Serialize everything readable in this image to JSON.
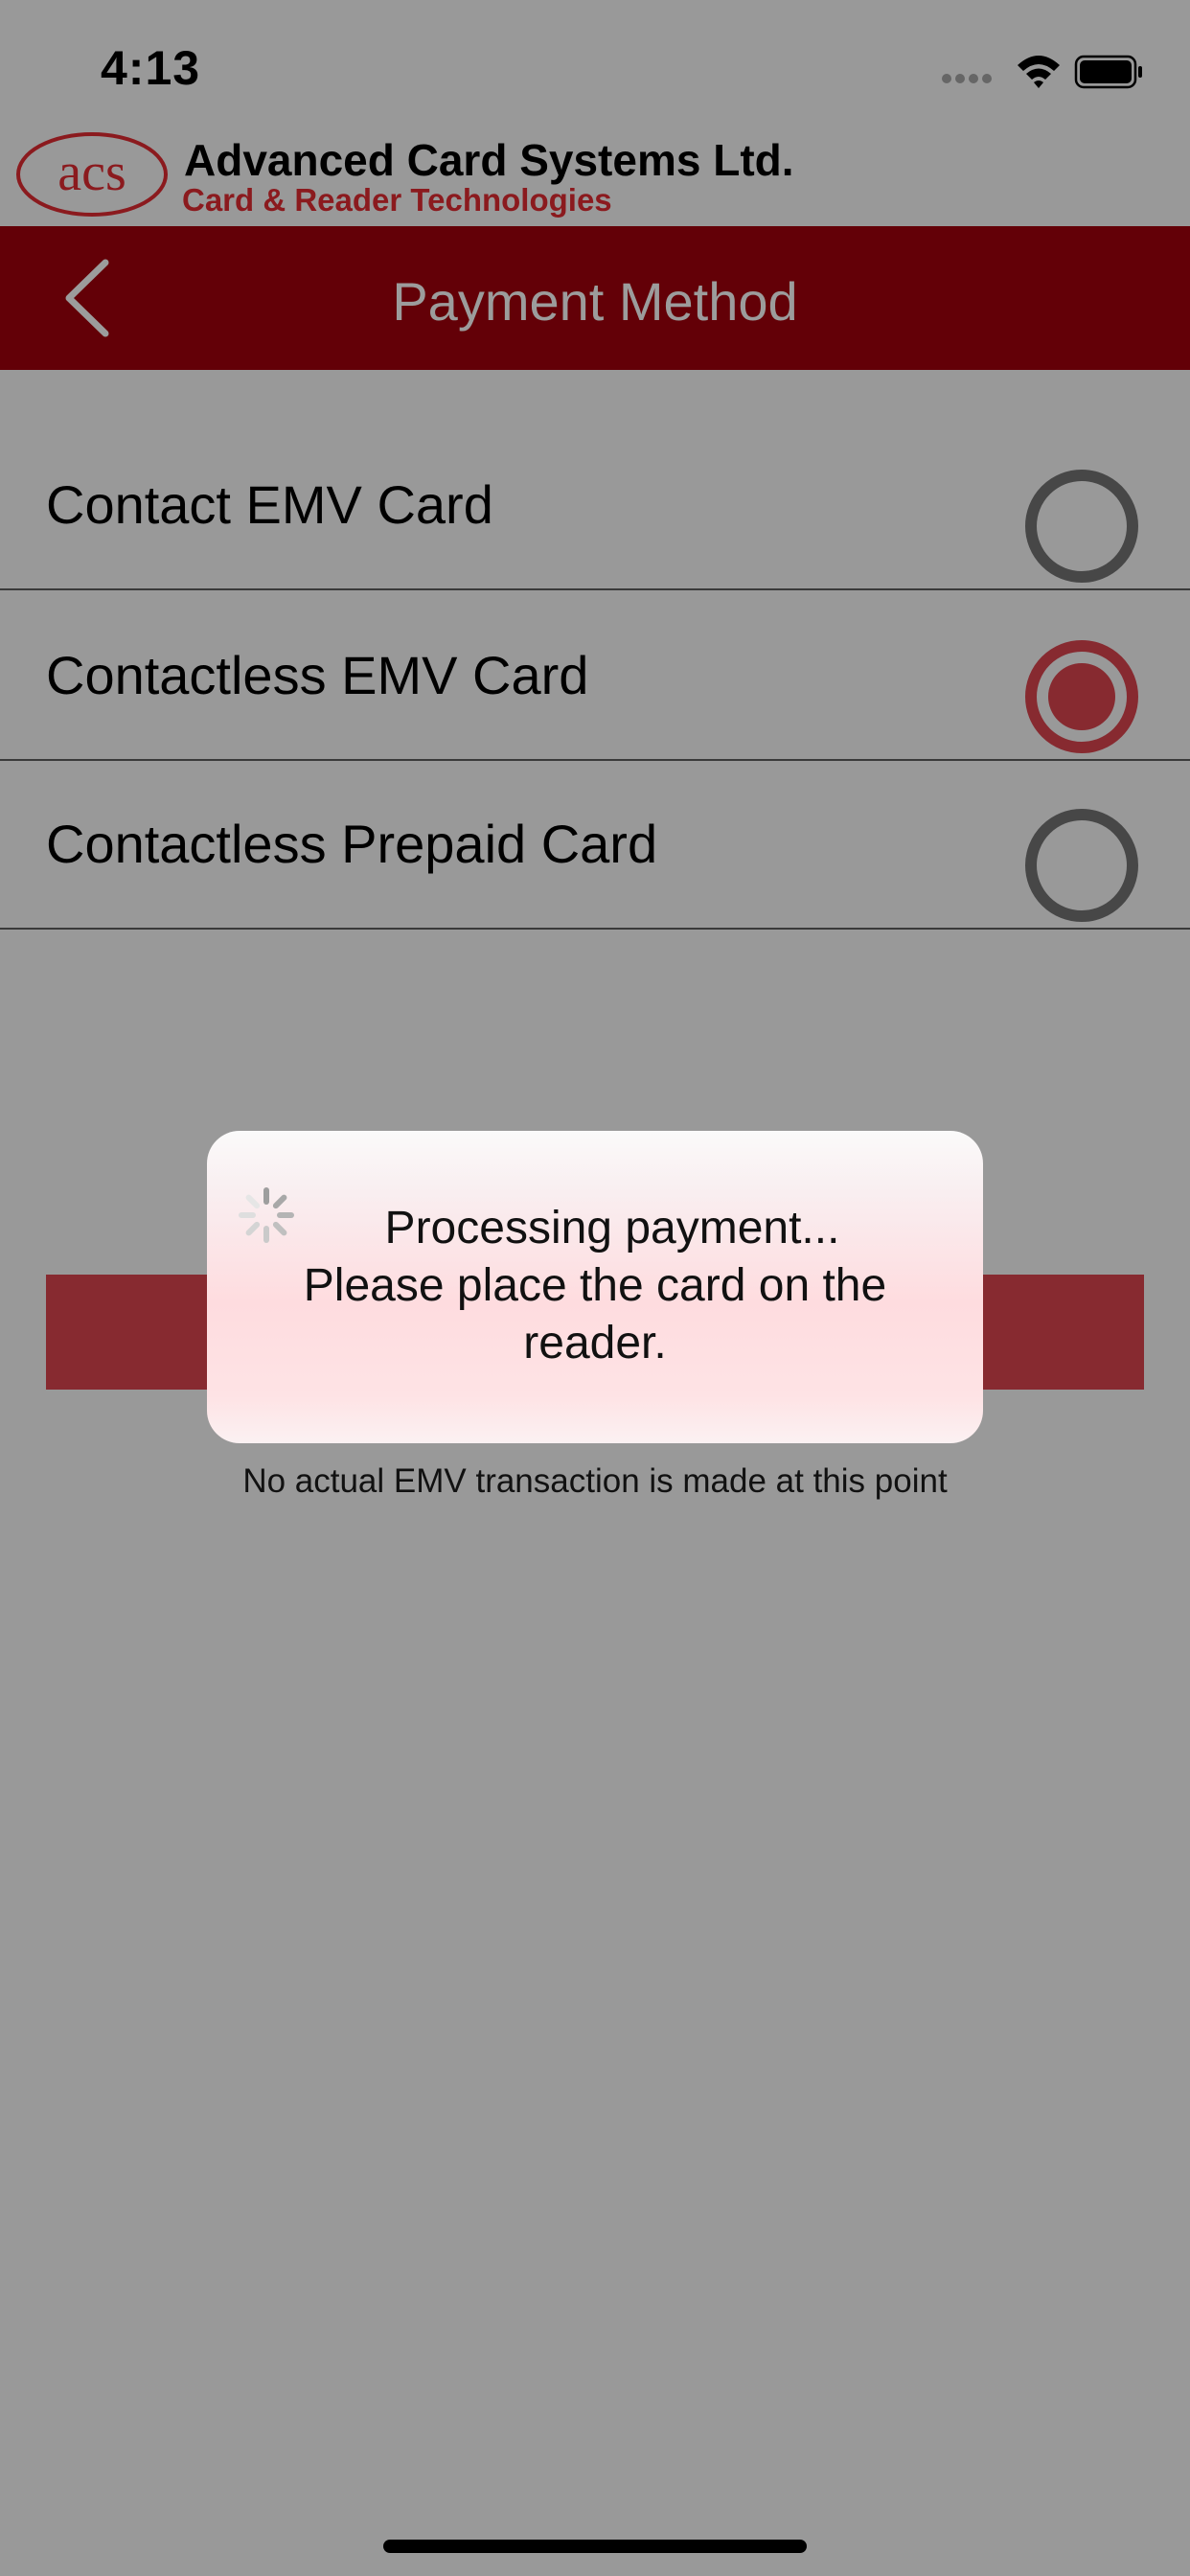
{
  "status_bar": {
    "time": "4:13",
    "icons": [
      "signal-icon",
      "wifi-icon",
      "battery-icon"
    ]
  },
  "logo": {
    "mark": "acs",
    "title": "Advanced Card Systems Ltd.",
    "subtitle": "Card & Reader Technologies"
  },
  "nav": {
    "back_icon": "chevron-left-icon",
    "title": "Payment Method"
  },
  "payment_methods": [
    {
      "label": "Contact EMV Card",
      "selected": false
    },
    {
      "label": "Contactless EMV Card",
      "selected": true
    },
    {
      "label": "Contactless Prepaid Card",
      "selected": false
    }
  ],
  "footnote": "No actual EMV transaction is made at this point",
  "popup": {
    "line1": "Processing payment...",
    "line2": "Please place the card on the",
    "line3": "reader."
  },
  "colors": {
    "brand_red": "#630007",
    "accent_red": "#872a30",
    "background": "#999999"
  }
}
